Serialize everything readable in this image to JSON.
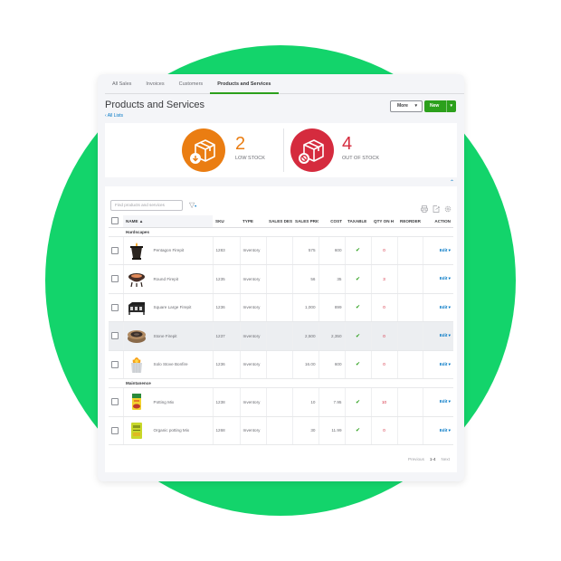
{
  "tabs": [
    {
      "label": "All Sales",
      "active": false
    },
    {
      "label": "Invoices",
      "active": false
    },
    {
      "label": "Customers",
      "active": false
    },
    {
      "label": "Products and Services",
      "active": true
    }
  ],
  "header": {
    "title": "Products and Services",
    "back_link": "All Lists",
    "more_label": "More",
    "new_label": "New"
  },
  "stock": {
    "low": {
      "count": "2",
      "label": "LOW STOCK",
      "color": "#ea7d12",
      "icon": "box-arrow-down-icon"
    },
    "out": {
      "count": "4",
      "label": "OUT OF STOCK",
      "color": "#d52b3e",
      "icon": "box-blocked-icon"
    }
  },
  "toolbar": {
    "search_placeholder": "Find products and services",
    "icons": [
      "print-icon",
      "export-icon",
      "settings-gear-icon"
    ]
  },
  "table": {
    "columns": [
      "NAME ▲",
      "SKU",
      "TYPE",
      "SALES DES",
      "SALES PRIC",
      "COST",
      "TAXABLE",
      "QTY ON H",
      "REORDER",
      "ACTION"
    ],
    "groups": [
      {
        "name": "Hardscapes",
        "rows": [
          {
            "name": "Pentagon Firepit",
            "sku": "1283",
            "type": "Inventory",
            "sales_desc": "",
            "price": "575",
            "cost": "600",
            "taxable": "✔",
            "qty": "0",
            "reorder": "",
            "action": "Edit ▾",
            "thumb": "pentagon-firepit-image"
          },
          {
            "name": "Round Firepit",
            "sku": "1235",
            "type": "Inventory",
            "sales_desc": "",
            "price": "56",
            "cost": "35",
            "taxable": "✔",
            "qty": "3",
            "reorder": "",
            "action": "Edit ▾",
            "thumb": "round-firepit-image"
          },
          {
            "name": "Square Large Firepit",
            "sku": "1236",
            "type": "Inventory",
            "sales_desc": "",
            "price": "1,000",
            "cost": "899",
            "taxable": "✔",
            "qty": "0",
            "reorder": "",
            "action": "Edit ▾",
            "thumb": "square-firepit-image"
          },
          {
            "name": "Stone Firepit",
            "sku": "1237",
            "type": "Inventory",
            "sales_desc": "",
            "price": "2,500",
            "cost": "2,350",
            "taxable": "✔",
            "qty": "0",
            "reorder": "",
            "action": "Edit ▾",
            "thumb": "stone-firepit-image",
            "highlighted": true
          },
          {
            "name": "Solo Stove Bonfire",
            "sku": "1236",
            "type": "Inventory",
            "sales_desc": "",
            "price": "16.00",
            "cost": "600",
            "taxable": "✔",
            "qty": "0",
            "reorder": "",
            "action": "Edit ▾",
            "thumb": "solo-stove-image"
          }
        ]
      },
      {
        "name": "Maintanence",
        "rows": [
          {
            "name": "Potting Mix",
            "sku": "1238",
            "type": "Inventory",
            "sales_desc": "",
            "price": "10",
            "cost": "7.95",
            "taxable": "✔",
            "qty": "10",
            "reorder": "",
            "action": "Edit ▾",
            "thumb": "potting-mix-image"
          },
          {
            "name": "Organic potting Mix",
            "sku": "1268",
            "type": "Inventory",
            "sales_desc": "",
            "price": "30",
            "cost": "11.99",
            "taxable": "✔",
            "qty": "0",
            "reorder": "",
            "action": "Edit ▾",
            "thumb": "organic-potting-mix-image"
          }
        ]
      }
    ]
  },
  "pager": {
    "previous": "Previous",
    "range": "1-4",
    "next": "Next"
  },
  "colors": {
    "accent_green": "#2ca01c",
    "link_blue": "#0077c5",
    "background_circle": "#13d46b"
  }
}
